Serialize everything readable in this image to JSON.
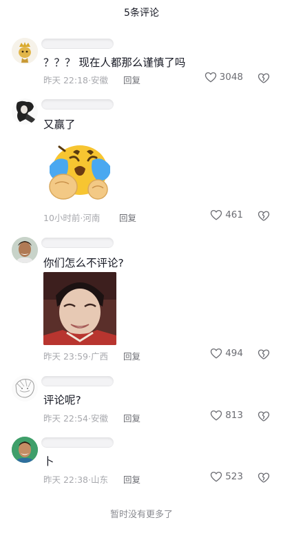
{
  "header": {
    "title": "5条评论"
  },
  "comments": [
    {
      "text": "？？？ 现在人都那么谨慎了吗",
      "time": "昨天 22:18",
      "location": "安徽",
      "reply_label": "回复",
      "likes": "3048"
    },
    {
      "text": "又赢了",
      "time": "10小时前",
      "location": "河南",
      "reply_label": "回复",
      "likes": "461",
      "sticker": "crying-emoji-sticker"
    },
    {
      "text": "你们怎么不评论?",
      "time": "昨天 23:59",
      "location": "广西",
      "reply_label": "回复",
      "likes": "494",
      "image": "smiling-face-photo"
    },
    {
      "text": "评论呢?",
      "time": "昨天 22:54",
      "location": "安徽",
      "reply_label": "回复",
      "likes": "813"
    },
    {
      "text": "卜",
      "time": "昨天 22:38",
      "location": "山东",
      "reply_label": "回复",
      "likes": "523"
    }
  ],
  "footer": {
    "text": "暂时没有更多了"
  },
  "icons": {
    "like": "heart-outline-icon",
    "dislike": "broken-heart-icon"
  },
  "colors": {
    "text": "#161823",
    "meta": "#a7a8ad",
    "sticker_yellow": "#f7c531",
    "tears_blue": "#4aa8f0"
  }
}
